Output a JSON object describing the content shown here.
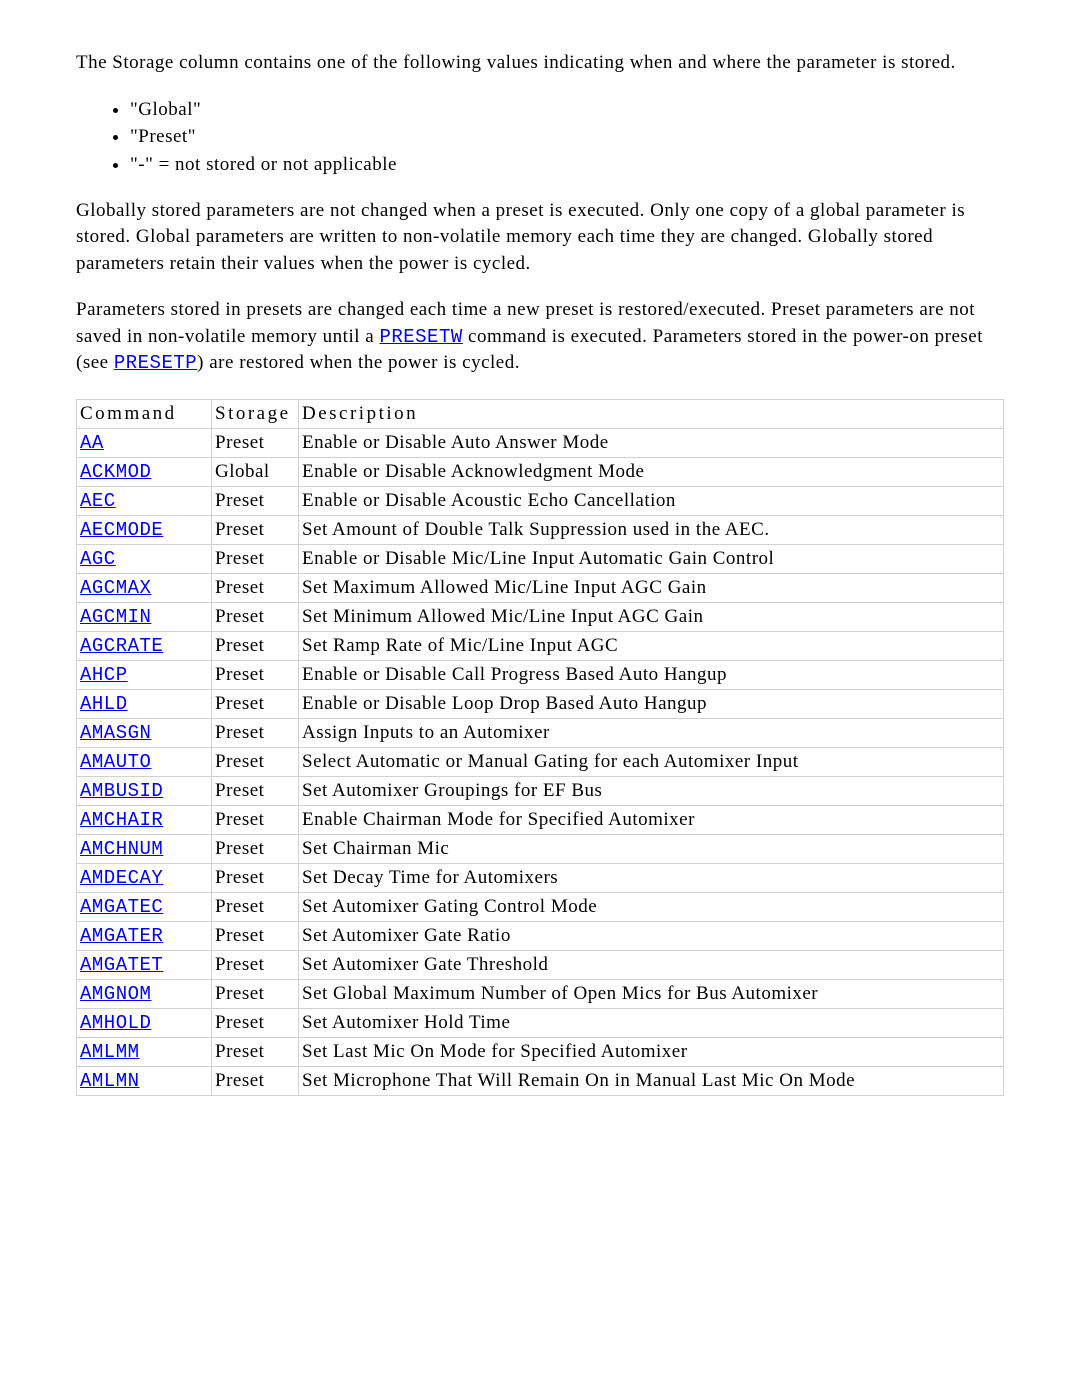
{
  "intro": {
    "p1": "The Storage column contains one of the following values indicating when and where the parameter is stored.",
    "bullets": [
      "\"Global\"",
      "\"Preset\"",
      "\"-\" = not stored or not applicable"
    ],
    "p2": "Globally stored parameters are not changed when a preset is executed. Only one copy of a global parameter is stored. Global parameters are written to non-volatile memory each time they are changed. Globally stored parameters retain their values when the power is cycled.",
    "p3_a": "Parameters stored in presets are changed each time a new preset is restored/executed. Preset parameters are not saved in non-volatile memory until a ",
    "p3_link1": "PRESETW",
    "p3_b": " command is executed. Parameters stored in the power-on preset (see ",
    "p3_link2": "PRESETP",
    "p3_c": ") are restored when the power is cycled."
  },
  "table": {
    "headers": {
      "command": "Command",
      "storage": "Storage",
      "description": "Description"
    },
    "rows": [
      {
        "cmd": "AA",
        "storage": "Preset",
        "desc": "Enable or Disable Auto Answer Mode"
      },
      {
        "cmd": "ACKMOD",
        "storage": "Global",
        "desc": "Enable or Disable Acknowledgment Mode"
      },
      {
        "cmd": "AEC",
        "storage": "Preset",
        "desc": "Enable or Disable Acoustic Echo Cancellation"
      },
      {
        "cmd": "AECMODE",
        "storage": "Preset",
        "desc": "Set Amount of Double Talk Suppression used in the AEC."
      },
      {
        "cmd": "AGC",
        "storage": "Preset",
        "desc": "Enable or Disable Mic/Line Input Automatic Gain Control"
      },
      {
        "cmd": "AGCMAX",
        "storage": "Preset",
        "desc": "Set Maximum Allowed Mic/Line Input AGC Gain"
      },
      {
        "cmd": "AGCMIN",
        "storage": "Preset",
        "desc": "Set Minimum Allowed Mic/Line Input AGC Gain"
      },
      {
        "cmd": "AGCRATE",
        "storage": "Preset",
        "desc": "Set Ramp Rate of Mic/Line Input AGC"
      },
      {
        "cmd": "AHCP",
        "storage": "Preset",
        "desc": "Enable or Disable Call Progress Based Auto Hangup"
      },
      {
        "cmd": "AHLD",
        "storage": "Preset",
        "desc": "Enable or Disable Loop Drop Based Auto Hangup"
      },
      {
        "cmd": "AMASGN",
        "storage": "Preset",
        "desc": "Assign Inputs to an Automixer"
      },
      {
        "cmd": "AMAUTO",
        "storage": "Preset",
        "desc": "Select Automatic or Manual Gating for each Automixer Input"
      },
      {
        "cmd": "AMBUSID",
        "storage": "Preset",
        "desc": "Set Automixer Groupings for EF Bus"
      },
      {
        "cmd": "AMCHAIR",
        "storage": "Preset",
        "desc": "Enable Chairman Mode for Specified Automixer"
      },
      {
        "cmd": "AMCHNUM",
        "storage": "Preset",
        "desc": "Set Chairman Mic"
      },
      {
        "cmd": "AMDECAY",
        "storage": "Preset",
        "desc": "Set Decay Time for Automixers"
      },
      {
        "cmd": "AMGATEC",
        "storage": "Preset",
        "desc": "Set Automixer Gating Control Mode"
      },
      {
        "cmd": "AMGATER",
        "storage": "Preset",
        "desc": "Set Automixer Gate Ratio"
      },
      {
        "cmd": "AMGATET",
        "storage": "Preset",
        "desc": "Set Automixer Gate Threshold"
      },
      {
        "cmd": "AMGNOM",
        "storage": "Preset",
        "desc": "Set Global Maximum Number of Open Mics for Bus Automixer"
      },
      {
        "cmd": "AMHOLD",
        "storage": "Preset",
        "desc": "Set Automixer Hold Time"
      },
      {
        "cmd": "AMLMM",
        "storage": "Preset",
        "desc": "Set Last Mic On Mode for Specified Automixer"
      },
      {
        "cmd": "AMLMN",
        "storage": "Preset",
        "desc": "Set Microphone That Will Remain On in Manual Last Mic On Mode"
      }
    ]
  }
}
